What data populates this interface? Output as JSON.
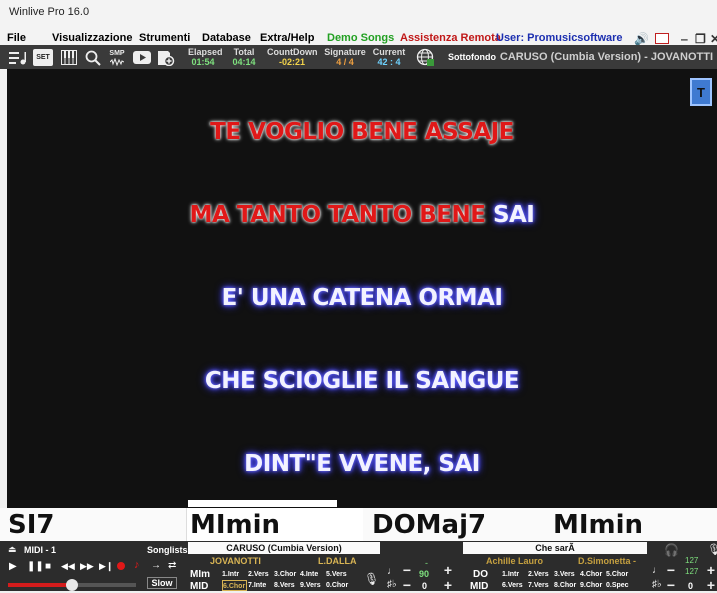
{
  "window": {
    "title": "Winlive Pro 16.0",
    "minimize": "‒",
    "maximize": "❐",
    "close": "✕"
  },
  "menu": [
    {
      "label": "File",
      "color": "#111111"
    },
    {
      "label": "Visualizzazione",
      "color": "#111111"
    },
    {
      "label": "Strumenti",
      "color": "#111111"
    },
    {
      "label": "Database",
      "color": "#111111"
    },
    {
      "label": "Extra/Help",
      "color": "#111111"
    },
    {
      "label": "Demo Songs",
      "color": "#22a022"
    },
    {
      "label": "Assistenza Remota",
      "color": "#c01818"
    },
    {
      "label": "User: Promusicsoftware",
      "color": "#1c2fb0"
    }
  ],
  "toolbar": {
    "set_label": "SET",
    "smp_label": "SMP",
    "elapsed": {
      "label": "Elapsed",
      "value": "01:54"
    },
    "total": {
      "label": "Total",
      "value": "04:14"
    },
    "countdown": {
      "label": "CountDown",
      "value": "-02:21"
    },
    "signature": {
      "label": "Signature",
      "value": "4 / 4"
    },
    "current": {
      "label": "Current",
      "value": "42 : 4"
    },
    "sottofondo_label": "Sottofondo",
    "song_title": "CARUSO (Cumbia Version) - JOVANOTTI"
  },
  "lyrics": {
    "line1": {
      "sung": "TE VOGLIO BENE ASSAJE",
      "unsung": ""
    },
    "line2": {
      "sung": "MA TANTO TANTO BENE",
      "unsung": " SAI"
    },
    "line3": {
      "sung": "",
      "unsung": "E' UNA CATENA ORMAI"
    },
    "line4": {
      "sung": "",
      "unsung": "CHE SCIOGLIE IL SANGUE"
    },
    "line5": {
      "sung": "",
      "unsung": "DINT\"E VVENE, SAI"
    },
    "t_button": "T"
  },
  "song_progress": 0.21,
  "chords": [
    "SI7",
    "MImin",
    "DOMaj7",
    "MImin"
  ],
  "player": {
    "midi_label": "MIDI - 1",
    "songlists_label": "Songlists",
    "slow_label": "Slow",
    "volume_level": 0.5,
    "deck1": {
      "title": "CARUSO (Cumbia Version)",
      "artist": "JOVANOTTI",
      "author": "L.DALLA",
      "key": "MIm",
      "type": "MID",
      "slots_row1": [
        "1.Intr",
        "2.Vers",
        "3.Chor",
        "4.Inte",
        "5.Vers"
      ],
      "slots_row2": [
        "6.Chor",
        "7.Inte",
        "8.Vers",
        "9.Vers",
        "0.Chor"
      ],
      "tempo": "90",
      "tempo_dash": "-",
      "transpose": "0"
    },
    "deck2": {
      "title": "Che sarÃ",
      "artist": "Achille Lauro",
      "author": "D.Simonetta -",
      "key": "DO",
      "type": "MID",
      "slots_row1": [
        "1.Intr",
        "2.Vers",
        "3.Vers",
        "4.Chor",
        "5.Chor"
      ],
      "slots_row2": [
        "6.Vers",
        "7.Vers",
        "8.Chor",
        "9.Chor",
        "0.Spec"
      ],
      "transpose": "0"
    },
    "volume_top": "127",
    "volume_bottom": "127",
    "volume_right": "0"
  }
}
